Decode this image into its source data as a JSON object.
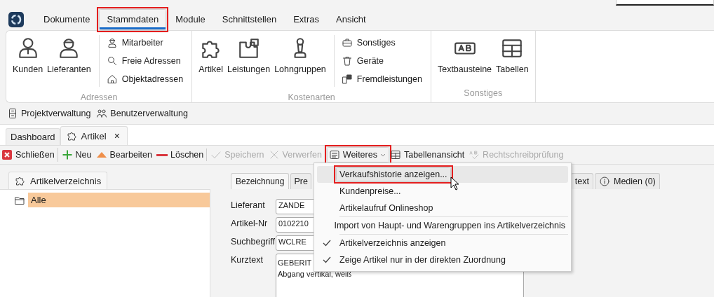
{
  "menu_bar": [
    {
      "label": "Dokumente",
      "selected": false,
      "highlighted": false
    },
    {
      "label": "Stammdaten",
      "selected": true,
      "highlighted": true
    },
    {
      "label": "Module",
      "selected": false,
      "highlighted": false
    },
    {
      "label": "Schnittstellen",
      "selected": false,
      "highlighted": false
    },
    {
      "label": "Extras",
      "selected": false,
      "highlighted": false
    },
    {
      "label": "Ansicht",
      "selected": false,
      "highlighted": false
    }
  ],
  "ribbon": {
    "groups": [
      {
        "label": "Adressen",
        "large": [
          {
            "label": "Kunden"
          },
          {
            "label": "Lieferanten"
          }
        ],
        "small": [
          {
            "label": "Mitarbeiter"
          },
          {
            "label": "Freie Adressen"
          },
          {
            "label": "Objektadressen"
          }
        ]
      },
      {
        "label": "Kostenarten",
        "large": [
          {
            "label": "Artikel"
          },
          {
            "label": "Leistungen"
          },
          {
            "label": "Lohngruppen"
          }
        ],
        "small": [
          {
            "label": "Sonstiges"
          },
          {
            "label": "Geräte"
          },
          {
            "label": "Fremdleistungen"
          }
        ]
      },
      {
        "label": "Sonstiges",
        "large": [
          {
            "label": "Textbausteine"
          },
          {
            "label": "Tabellen"
          }
        ]
      }
    ]
  },
  "quick_access": [
    {
      "label": "Projektverwaltung"
    },
    {
      "label": "Benutzerverwaltung"
    }
  ],
  "document_tabs": [
    {
      "label": "Dashboard",
      "selected": false
    },
    {
      "label": "Artikel",
      "selected": true,
      "close": "×"
    }
  ],
  "toolbar": [
    {
      "label": "Schließen",
      "disabled": false,
      "highlighted": false,
      "divider_after": true
    },
    {
      "label": "Neu",
      "disabled": false,
      "highlighted": false,
      "divider_after": false
    },
    {
      "label": "Bearbeiten",
      "disabled": false,
      "highlighted": false,
      "divider_after": false
    },
    {
      "label": "Löschen",
      "disabled": false,
      "highlighted": false,
      "divider_after": true
    },
    {
      "label": "Speichern",
      "disabled": true,
      "highlighted": false,
      "divider_after": false
    },
    {
      "label": "Verwerfen",
      "disabled": true,
      "highlighted": false,
      "divider_after": true
    },
    {
      "label": "Weiteres",
      "disabled": false,
      "highlighted": true,
      "dropdown": true,
      "divider_after": false
    },
    {
      "label": "Tabellenansicht",
      "disabled": false,
      "highlighted": false,
      "divider_after": false
    },
    {
      "label": "Rechtschreibprüfung",
      "disabled": true,
      "highlighted": false,
      "divider_after": false
    }
  ],
  "sidebar": {
    "tab": "Artikelverzeichnis",
    "tree": [
      {
        "label": "Alle",
        "selected": true
      }
    ]
  },
  "detail_tabs": [
    {
      "label": "Bezeichnung",
      "selected": true
    },
    {
      "label": "Pre",
      "selected": false
    },
    {
      "label": "text",
      "selected": false
    },
    {
      "label": "Medien (0)",
      "selected": false
    }
  ],
  "form": [
    {
      "label": "Lieferant",
      "value": "ZANDE"
    },
    {
      "label": "Artikel-Nr",
      "value": "0102210"
    },
    {
      "label": "Suchbegriff",
      "value": "WCLRE"
    },
    {
      "label": "Kurztext",
      "value": "GEBERIT\nAbgang vertikal, weiß",
      "multiline": true
    }
  ],
  "dropdown": {
    "items": [
      {
        "label": "Verkaufshistorie anzeigen...",
        "checked": false,
        "hovered": true,
        "highlighted": true,
        "separator_before": false
      },
      {
        "label": "Kundenpreise...",
        "checked": false,
        "hovered": false,
        "highlighted": false,
        "separator_before": false
      },
      {
        "label": "Artikelaufruf Onlineshop",
        "checked": false,
        "hovered": false,
        "highlighted": false,
        "separator_before": false
      },
      {
        "label": "Import von Haupt- und Warengruppen ins Artikelverzeichnis",
        "checked": false,
        "hovered": false,
        "highlighted": false,
        "separator_before": true
      },
      {
        "label": "Artikelverzeichnis anzeigen",
        "checked": true,
        "hovered": false,
        "highlighted": false,
        "separator_before": true
      },
      {
        "label": "Zeige Artikel nur in der direkten Zuordnung",
        "checked": true,
        "hovered": false,
        "highlighted": false,
        "separator_before": false
      }
    ]
  }
}
